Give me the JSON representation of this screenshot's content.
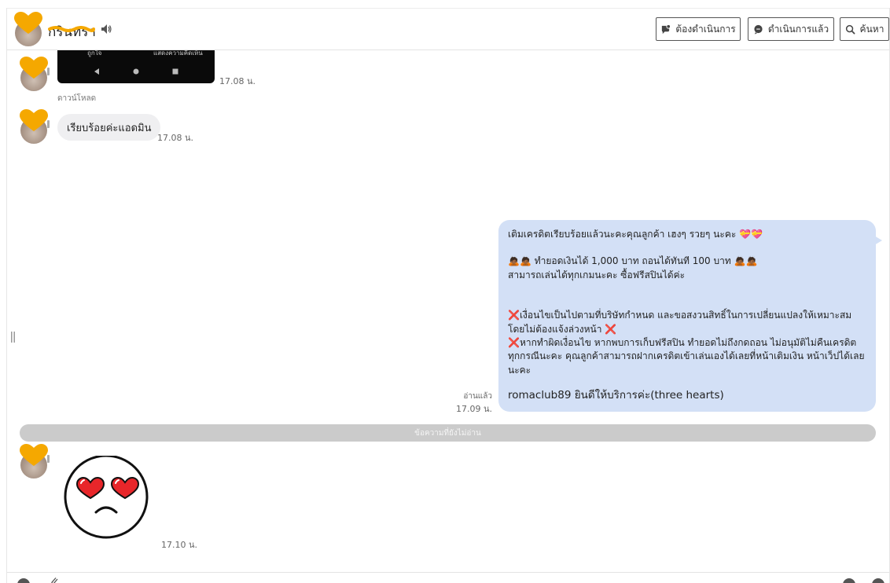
{
  "header": {
    "contact_name": "กรินทรา",
    "buttons": {
      "pending": "ต้องดำเนินการ",
      "done": "ดำเนินการแล้ว",
      "search": "ค้นหา"
    }
  },
  "messages": {
    "image_msg": {
      "top_text_left": "ถูกใจ",
      "top_text_right": "แสดงความคิดเห็น",
      "time": "17.08 น.",
      "download_label": "ดาวน์โหลด"
    },
    "text_msg": {
      "text": "เรียบร้อยค่ะแอดมิน",
      "time": "17.08 น."
    },
    "agent_msg": {
      "line1": "เติมเครดิตเรียบร้อยแล้วนะคะคุณลูกค้า เฮงๆ รวยๆ นะคะ 💝💝",
      "line2": "🙇🏾🙇🏾 ทำยอดเงินได้ 1,000 บาท ถอนได้ทันที 100 บาท 🙇🏾🙇🏾",
      "line3": "สามารถเล่นได้ทุกเกมนะคะ  ซื้อฟรีสปินได้ค่ะ",
      "line4": "❌เงื่อนไขเป็นไปตามที่บริษัทกำหนด และขอสงวนสิทธิ์ในการเปลี่ยนแปลงให้เหมาะสมโดยไม่ต้องแจ้งล่วงหน้า ❌",
      "line5": "❌หากทำผิดเงื่อนไข หากพบการเก็บฟรีสปิน ทำยอดไม่ถึงกดถอน ไม่อนุมัติไม่คืนเครดิตทุกกรณีนะคะ คุณลูกค้าสามารถฝากเครดิตเข้าเล่นเองได้เลยที่หน้าเติมเงิน หน้าเว็ปได้เลยนะคะ",
      "line6": "romaclub89 ยินดีให้บริการค่ะ(three hearts)",
      "read_status": "อ่านแล้ว",
      "time": "17.09 น."
    },
    "unread_divider": "ข้อความที่ยังไม่อ่าน",
    "sticker_msg": {
      "time": "17.10 น."
    }
  },
  "colors": {
    "agent_bubble": "#d3e0f6",
    "customer_bubble": "#efeff1",
    "divider": "#cbcbcb",
    "avatar_heart": "#f5a800"
  },
  "icons": {
    "speaker": "speaker-icon",
    "pending": "chat-bubble-icon",
    "done": "chat-check-icon",
    "search": "search-icon",
    "sticker": "heart-eyes-sticker"
  }
}
